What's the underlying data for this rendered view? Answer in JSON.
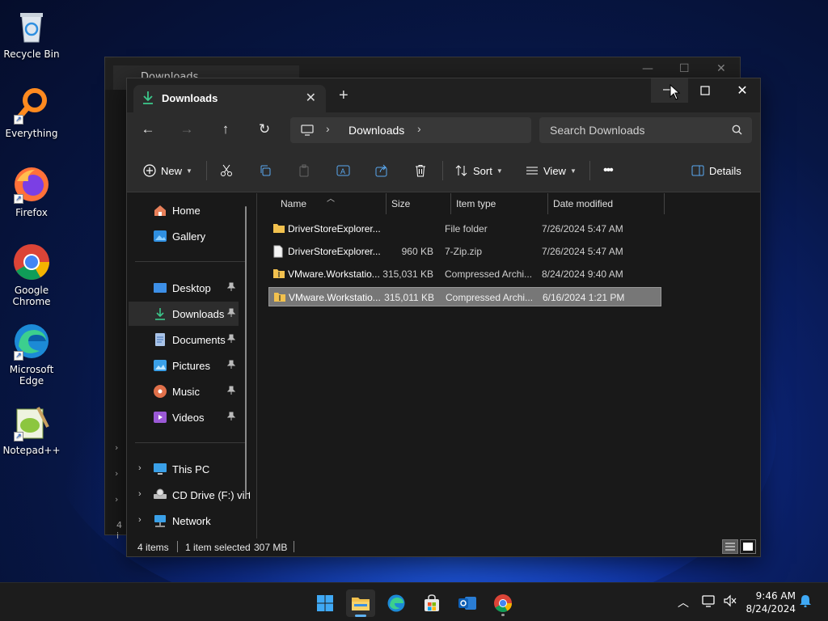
{
  "desktop": {
    "icons": [
      {
        "label": "Recycle Bin"
      },
      {
        "label": "Everything"
      },
      {
        "label": "Firefox"
      },
      {
        "label": "Google Chrome"
      },
      {
        "label": "Microsoft Edge"
      },
      {
        "label": "Notepad++"
      }
    ]
  },
  "background_window": {
    "tab_title": "Downloads",
    "status_fragment": "4 i"
  },
  "window": {
    "tab_title": "Downloads",
    "address": {
      "crumb": "Downloads"
    },
    "search": {
      "placeholder": "Search Downloads"
    },
    "toolbar": {
      "new_label": "New",
      "sort_label": "Sort",
      "view_label": "View",
      "more_label": "•••",
      "details_label": "Details"
    },
    "sidebar": {
      "quick": [
        {
          "label": "Home"
        },
        {
          "label": "Gallery"
        }
      ],
      "pinned": [
        {
          "label": "Desktop"
        },
        {
          "label": "Downloads"
        },
        {
          "label": "Documents"
        },
        {
          "label": "Pictures"
        },
        {
          "label": "Music"
        },
        {
          "label": "Videos"
        }
      ],
      "tree": [
        {
          "label": "This PC"
        },
        {
          "label": "CD Drive (F:) virt"
        },
        {
          "label": "Network"
        }
      ]
    },
    "columns": {
      "name": "Name",
      "size": "Size",
      "type": "Item type",
      "date": "Date modified"
    },
    "files": [
      {
        "name": "DriverStoreExplorer....",
        "size": "",
        "type": "File folder",
        "date": "7/26/2024 5:47 AM"
      },
      {
        "name": "DriverStoreExplorer....",
        "size": "960 KB",
        "type": "7-Zip.zip",
        "date": "7/26/2024 5:47 AM"
      },
      {
        "name": "VMware.Workstatio...",
        "size": "315,031 KB",
        "type": "Compressed Archi...",
        "date": "8/24/2024 9:40 AM"
      },
      {
        "name": "VMware.Workstatio...",
        "size": "315,011 KB",
        "type": "Compressed Archi...",
        "date": "6/16/2024 1:21 PM"
      }
    ],
    "status": {
      "count": "4 items",
      "selection": "1 item selected",
      "selection_size": "307 MB"
    }
  },
  "taskbar": {
    "time": "9:46 AM",
    "date": "8/24/2024"
  },
  "colors": {
    "accent_green": "#3cc68a",
    "folder_yellow": "#f2c14e",
    "selection_gray": "#777777"
  }
}
